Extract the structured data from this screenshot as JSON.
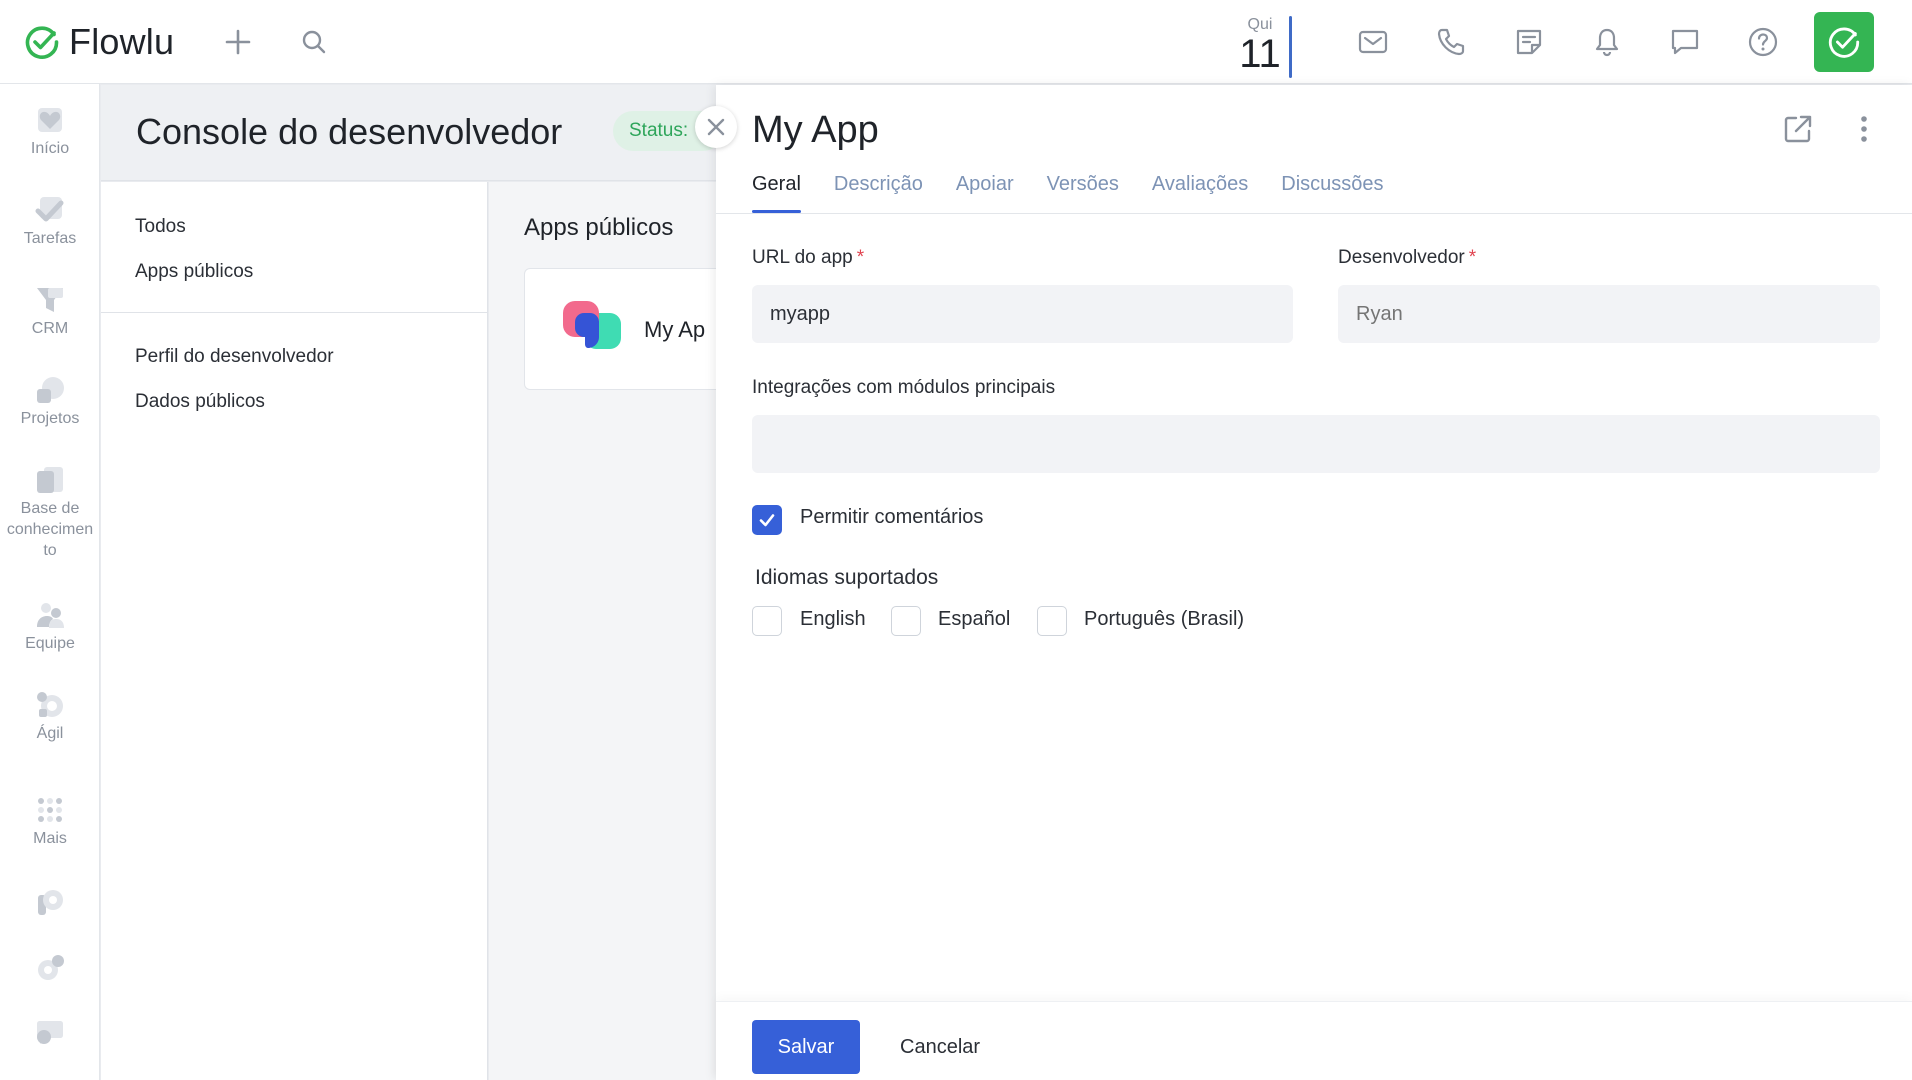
{
  "topbar": {
    "logo_text": "Flowlu",
    "date_day": "Qui",
    "date_num": "11",
    "icons": [
      "plus-icon",
      "search-icon",
      "mail-icon",
      "phone-icon",
      "note-icon",
      "bell-icon",
      "chat-icon",
      "help-icon",
      "profile-icon"
    ]
  },
  "nav": {
    "items": [
      {
        "label": "Início",
        "icon": "heart-icon"
      },
      {
        "label": "Tarefas",
        "icon": "check-icon"
      },
      {
        "label": "CRM",
        "icon": "funnel-icon"
      },
      {
        "label": "Projetos",
        "icon": "projects-icon"
      },
      {
        "label": "Base de conhecimen to",
        "icon": "book-icon"
      },
      {
        "label": "Equipe",
        "icon": "team-icon"
      },
      {
        "label": "Ágil",
        "icon": "agile-icon"
      },
      {
        "label": "Mais",
        "icon": "grid-icon"
      }
    ],
    "bottom_icons": [
      "parking-icon",
      "gear-icon",
      "support-icon"
    ]
  },
  "page": {
    "title": "Console do desenvolvedor",
    "status_label": "Status:",
    "menu": [
      "Todos",
      "Apps públicos",
      "Perfil do desenvolvedor",
      "Dados públicos"
    ],
    "content_title": "Apps públicos",
    "card_name": "My Ap"
  },
  "drawer": {
    "title": "My App",
    "tabs": [
      "Geral",
      "Descrição",
      "Apoiar",
      "Versões",
      "Avaliações",
      "Discussões"
    ],
    "fields": {
      "url_label": "URL do app",
      "url_value": "myapp",
      "developer_label": "Desenvolvedor",
      "developer_placeholder": "Ryan",
      "integrations_label": "Integrações com módulos principais",
      "integrations_value": ""
    },
    "allow_comments_label": "Permitir comentários",
    "allow_comments_checked": true,
    "languages_title": "Idiomas suportados",
    "languages": [
      {
        "label": "English",
        "checked": false
      },
      {
        "label": "Español",
        "checked": false
      },
      {
        "label": "Português (Brasil)",
        "checked": false
      }
    ],
    "save_label": "Salvar",
    "cancel_label": "Cancelar"
  },
  "colors": {
    "accent": "#3660d8",
    "brand_green": "#34b553",
    "status_green": "#2ea55a",
    "required": "#e0434f"
  }
}
